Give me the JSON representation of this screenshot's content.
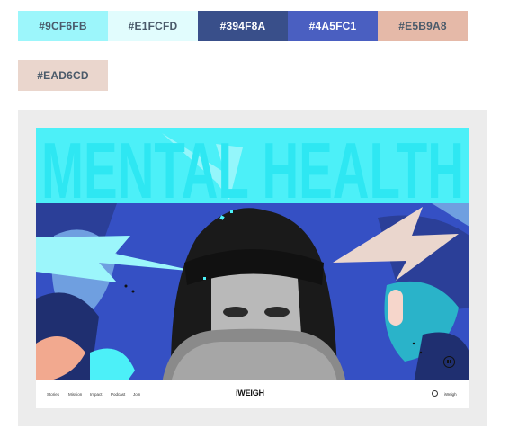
{
  "palette": [
    {
      "label": "#9CF6FB",
      "color": "#9CF6FB",
      "text": "#4a5a6a"
    },
    {
      "label": "#E1FCFD",
      "color": "#E1FCFD",
      "text": "#4a5a6a"
    },
    {
      "label": "#394F8A",
      "color": "#394F8A",
      "text": "#ffffff"
    },
    {
      "label": "#4A5FC1",
      "color": "#4A5FC1",
      "text": "#ffffff"
    },
    {
      "label": "#E5B9A8",
      "color": "#E5B9A8",
      "text": "#4a5a6a"
    },
    {
      "label": "#EAD6CD",
      "color": "#EAD6CD",
      "text": "#4a5a6a"
    }
  ],
  "preview": {
    "headline": "MENTAL HEALTH",
    "brand": "iWEIGH",
    "nav": [
      "Stories",
      "Mission",
      "Impact",
      "Podcast",
      "Join"
    ],
    "nav_right": "iWeigh",
    "icons": [
      "pause-icon",
      "search-icon"
    ]
  }
}
